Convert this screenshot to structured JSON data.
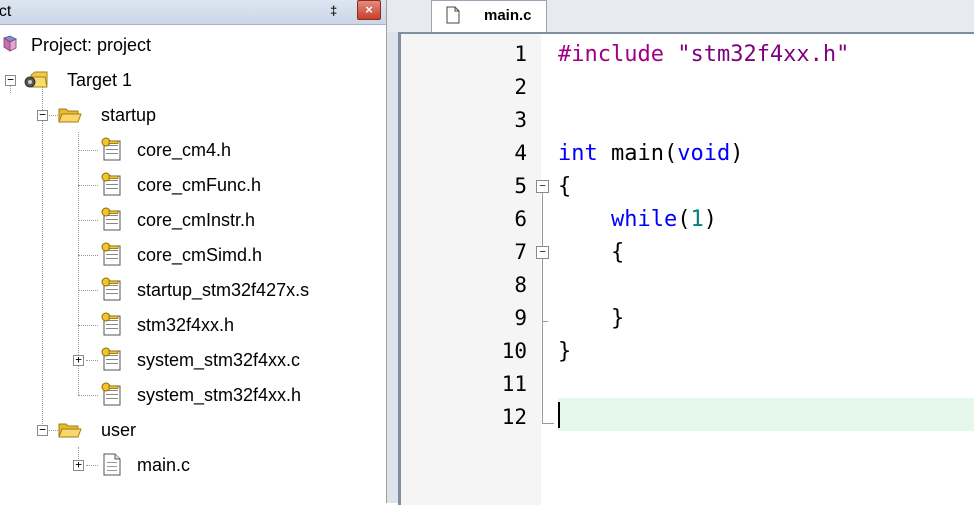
{
  "project_panel": {
    "title": "ect",
    "pin_icon": "‡",
    "close_glyph": "×",
    "tree": {
      "project_label": "Project: project",
      "target_label": "Target 1",
      "startup_folder": "startup",
      "startup_files": [
        "core_cm4.h",
        "core_cmFunc.h",
        "core_cmInstr.h",
        "core_cmSimd.h",
        "startup_stm32f427x.s",
        "stm32f4xx.h",
        "system_stm32f4xx.c",
        "system_stm32f4xx.h"
      ],
      "user_folder": "user",
      "user_files": [
        "main.c"
      ]
    }
  },
  "editor": {
    "tab_label": "main.c",
    "line_numbers": [
      "1",
      "2",
      "3",
      "4",
      "5",
      "6",
      "7",
      "8",
      "9",
      "10",
      "11",
      "12"
    ],
    "code": {
      "l1_directive": "#include",
      "l1_header": "\"stm32f4xx.h\"",
      "l4_type": "int",
      "l4_name": " main(",
      "l4_param": "void",
      "l4_close": ")",
      "l5": "{",
      "l6_kw": "while",
      "l6_open": "(",
      "l6_num": "1",
      "l6_close": ")",
      "l7": "{",
      "l9": "}",
      "l10": "}"
    },
    "current_line": 12
  },
  "colors": {
    "keyword": "#0000ff",
    "preprocessor": "#a00084",
    "string": "#7f007f",
    "number": "#008080",
    "current_line_bg": "#e6f8e9"
  }
}
